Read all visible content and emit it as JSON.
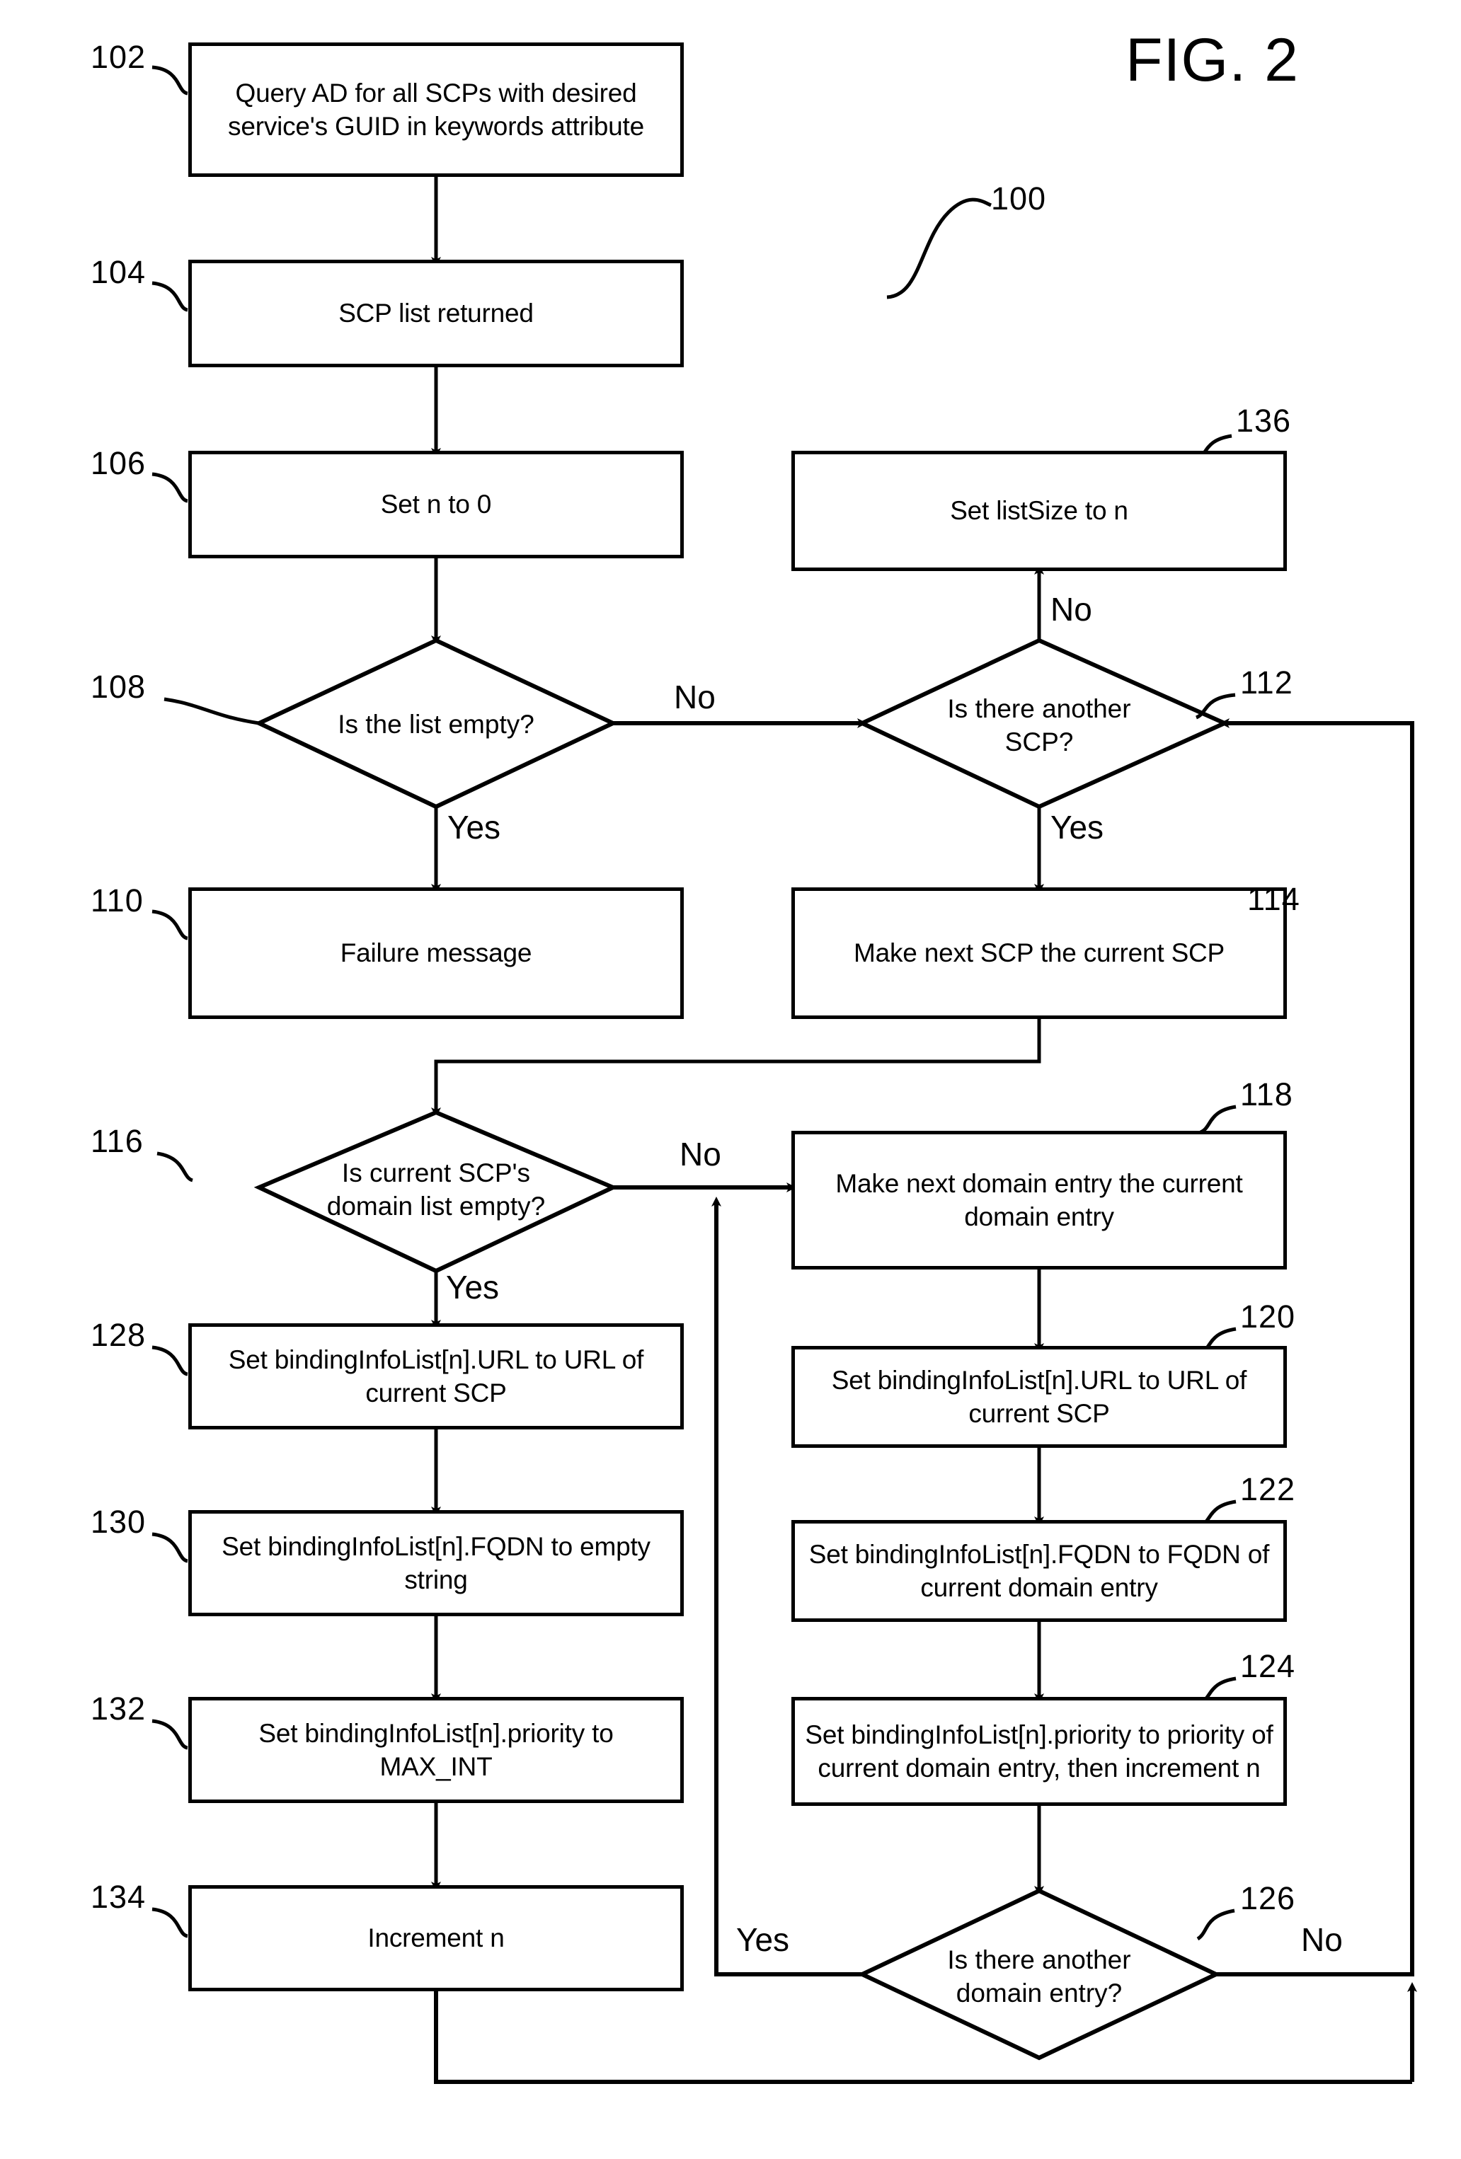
{
  "figure": {
    "title": "FIG. 2",
    "diagram_ref": "100"
  },
  "nodes": [
    {
      "ref": "102",
      "shape": "process",
      "text": "Query AD for all SCPs with desired service's GUID in keywords attribute"
    },
    {
      "ref": "104",
      "shape": "process",
      "text": "SCP list returned"
    },
    {
      "ref": "106",
      "shape": "process",
      "text": "Set n to 0"
    },
    {
      "ref": "108",
      "shape": "decision",
      "text": "Is the list empty?"
    },
    {
      "ref": "110",
      "shape": "process",
      "text": "Failure message"
    },
    {
      "ref": "112",
      "shape": "decision",
      "text": "Is there another\nSCP?"
    },
    {
      "ref": "114",
      "shape": "process",
      "text": "Make next SCP the current SCP"
    },
    {
      "ref": "116",
      "shape": "decision",
      "text": "Is current SCP's\ndomain list empty?"
    },
    {
      "ref": "118",
      "shape": "process",
      "text": "Make next domain entry the current domain entry"
    },
    {
      "ref": "120",
      "shape": "process",
      "text": "Set bindingInfoList[n].URL to URL of current SCP"
    },
    {
      "ref": "122",
      "shape": "process",
      "text": "Set bindingInfoList[n].FQDN to FQDN of current domain entry"
    },
    {
      "ref": "124",
      "shape": "process",
      "text": "Set bindingInfoList[n].priority to priority of current domain entry, then increment n"
    },
    {
      "ref": "126",
      "shape": "decision",
      "text": "Is there another\ndomain entry?"
    },
    {
      "ref": "128",
      "shape": "process",
      "text": "Set bindingInfoList[n].URL to URL of current SCP"
    },
    {
      "ref": "130",
      "shape": "process",
      "text": "Set bindingInfoList[n].FQDN to empty string"
    },
    {
      "ref": "132",
      "shape": "process",
      "text": "Set bindingInfoList[n].priority to MAX_INT"
    },
    {
      "ref": "134",
      "shape": "process",
      "text": "Increment n"
    },
    {
      "ref": "136",
      "shape": "process",
      "text": "Set listSize to n"
    }
  ],
  "edge_labels": {
    "e108_no": "No",
    "e108_yes": "Yes",
    "e112_no": "No",
    "e112_yes": "Yes",
    "e116_no": "No",
    "e116_yes": "Yes",
    "e126_yes": "Yes",
    "e126_no": "No"
  },
  "chart_data": {
    "type": "flowchart",
    "title": "FIG. 2",
    "diagram_ref": "100",
    "steps": [
      {
        "id": "102",
        "type": "process",
        "label": "Query AD for all SCPs with desired service's GUID in keywords attribute",
        "next": [
          "104"
        ]
      },
      {
        "id": "104",
        "type": "process",
        "label": "SCP list returned",
        "next": [
          "106"
        ]
      },
      {
        "id": "106",
        "type": "process",
        "label": "Set n to 0",
        "next": [
          "108"
        ]
      },
      {
        "id": "108",
        "type": "decision",
        "label": "Is the list empty?",
        "yes": "110",
        "no": "112"
      },
      {
        "id": "110",
        "type": "process",
        "label": "Failure message",
        "next": []
      },
      {
        "id": "112",
        "type": "decision",
        "label": "Is there another SCP?",
        "yes": "114",
        "no": "136"
      },
      {
        "id": "114",
        "type": "process",
        "label": "Make next SCP the current SCP",
        "next": [
          "116"
        ]
      },
      {
        "id": "116",
        "type": "decision",
        "label": "Is current SCP's domain list empty?",
        "yes": "128",
        "no": "118"
      },
      {
        "id": "118",
        "type": "process",
        "label": "Make next domain entry the current domain entry",
        "next": [
          "120"
        ]
      },
      {
        "id": "120",
        "type": "process",
        "label": "Set bindingInfoList[n].URL to URL of current SCP",
        "next": [
          "122"
        ]
      },
      {
        "id": "122",
        "type": "process",
        "label": "Set bindingInfoList[n].FQDN to FQDN of current domain entry",
        "next": [
          "124"
        ]
      },
      {
        "id": "124",
        "type": "process",
        "label": "Set bindingInfoList[n].priority to priority of current domain entry, then increment n",
        "next": [
          "126"
        ]
      },
      {
        "id": "126",
        "type": "decision",
        "label": "Is there another domain entry?",
        "yes": "118",
        "no": "112"
      },
      {
        "id": "128",
        "type": "process",
        "label": "Set bindingInfoList[n].URL to URL of current SCP",
        "next": [
          "130"
        ]
      },
      {
        "id": "130",
        "type": "process",
        "label": "Set bindingInfoList[n].FQDN to empty string",
        "next": [
          "132"
        ]
      },
      {
        "id": "132",
        "type": "process",
        "label": "Set bindingInfoList[n].priority to MAX_INT",
        "next": [
          "134"
        ]
      },
      {
        "id": "134",
        "type": "process",
        "label": "Increment n",
        "next": [
          "112"
        ]
      },
      {
        "id": "136",
        "type": "process",
        "label": "Set listSize to n",
        "next": []
      }
    ]
  }
}
